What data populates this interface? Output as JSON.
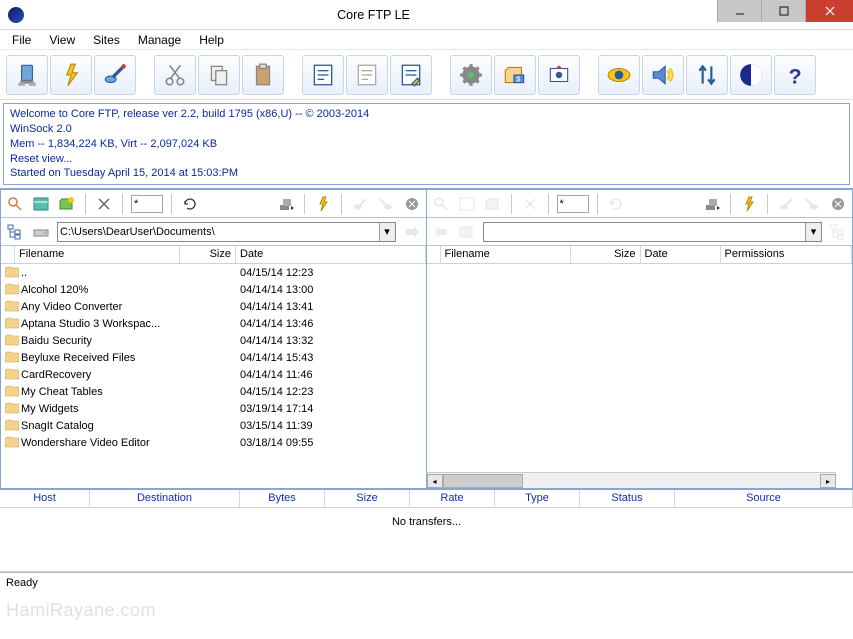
{
  "window": {
    "title": "Core FTP LE"
  },
  "menu": {
    "items": [
      "File",
      "View",
      "Sites",
      "Manage",
      "Help"
    ]
  },
  "log": {
    "lines": [
      "Welcome to Core FTP, release ver 2.2, build 1795 (x86,U) -- © 2003-2014",
      "WinSock 2.0",
      "Mem -- 1,834,224 KB, Virt -- 2,097,024 KB",
      "Reset view...",
      "Started on Tuesday April 15, 2014 at 15:03:PM"
    ]
  },
  "localPanel": {
    "filter": "*",
    "path": "C:\\Users\\DearUser\\Documents\\",
    "columns": {
      "filename": "Filename",
      "size": "Size",
      "date": "Date"
    },
    "files": [
      {
        "name": "..",
        "size": "",
        "date": "04/15/14 12:23"
      },
      {
        "name": "Alcohol 120%",
        "size": "",
        "date": "04/14/14 13:00"
      },
      {
        "name": "Any Video Converter",
        "size": "",
        "date": "04/14/14 13:41"
      },
      {
        "name": "Aptana Studio 3 Workspac...",
        "size": "",
        "date": "04/14/14 13:46"
      },
      {
        "name": "Baidu Security",
        "size": "",
        "date": "04/14/14 13:32"
      },
      {
        "name": "Beyluxe Received Files",
        "size": "",
        "date": "04/14/14 15:43"
      },
      {
        "name": "CardRecovery",
        "size": "",
        "date": "04/14/14 11:46"
      },
      {
        "name": "My Cheat Tables",
        "size": "",
        "date": "04/15/14 12:23"
      },
      {
        "name": "My Widgets",
        "size": "",
        "date": "03/19/14 17:14"
      },
      {
        "name": "SnagIt Catalog",
        "size": "",
        "date": "03/15/14 11:39"
      },
      {
        "name": "Wondershare Video Editor",
        "size": "",
        "date": "03/18/14 09:55"
      }
    ]
  },
  "remotePanel": {
    "filter": "*",
    "path": "",
    "columns": {
      "filename": "Filename",
      "size": "Size",
      "date": "Date",
      "perms": "Permissions"
    }
  },
  "queue": {
    "columns": [
      "Host",
      "Destination",
      "Bytes",
      "Size",
      "Rate",
      "Type",
      "Status",
      "Source"
    ],
    "empty_text": "No transfers..."
  },
  "status": {
    "text": "Ready"
  },
  "watermark": "HamiRayane.com"
}
